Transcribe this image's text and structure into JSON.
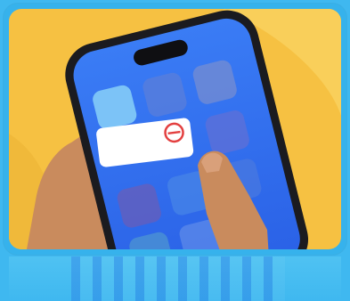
{
  "image": {
    "subject": "hand-holding-phone-illustration",
    "icons": {
      "remove_badge": "minus-circle-icon"
    },
    "colors": {
      "background": "#3fb8f0",
      "card_yellow": "#f6c142",
      "card_yellow_light": "#f9cf5a",
      "phone_frame": "#1b1b1f",
      "screen_blue": "#2f6df0",
      "skin": "#c98b5d",
      "remove_red": "#e34040",
      "widget_white": "#ffffff"
    }
  }
}
